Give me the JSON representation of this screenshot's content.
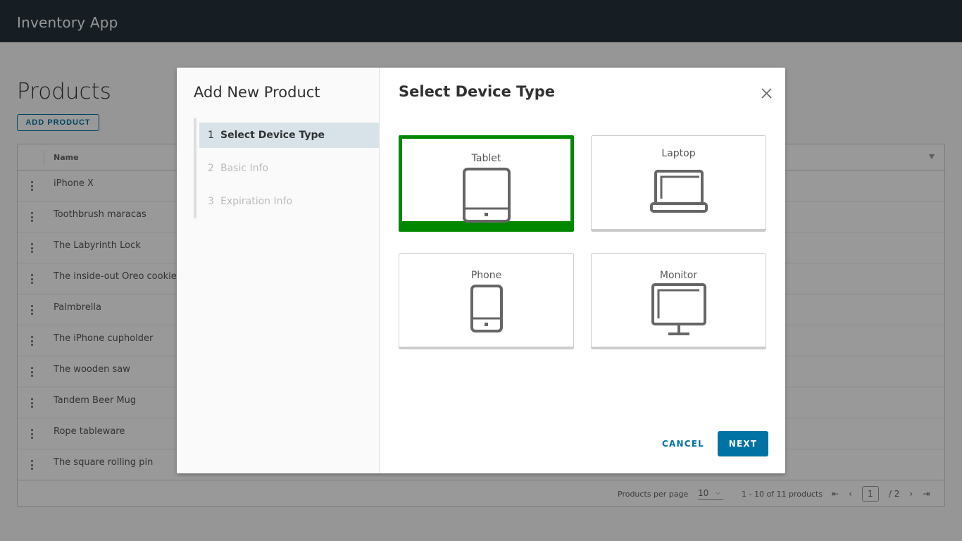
{
  "app": {
    "title": "Inventory App"
  },
  "page": {
    "title": "Products",
    "add_button": "ADD PRODUCT"
  },
  "grid": {
    "column_name": "Name",
    "rows": [
      "iPhone X",
      "Toothbrush maracas",
      "The Labyrinth Lock",
      "The inside-out Oreo cookie",
      "Palmbrella",
      "The iPhone cupholder",
      "The wooden saw",
      "Tandem Beer Mug",
      "Rope tableware",
      "The square rolling pin"
    ],
    "footer": {
      "per_page_label": "Products per page",
      "per_page_value": "10",
      "range_text": "1 - 10 of 11 products",
      "current_page": "1",
      "total_pages": "/ 2"
    }
  },
  "modal": {
    "side_title": "Add New Product",
    "steps": [
      {
        "num": "1",
        "label": "Select Device Type",
        "active": true
      },
      {
        "num": "2",
        "label": "Basic Info",
        "active": false
      },
      {
        "num": "3",
        "label": "Expiration Info",
        "active": false
      }
    ],
    "main_title": "Select Device Type",
    "options": [
      {
        "label": "Tablet",
        "icon": "tablet-icon",
        "selected": true
      },
      {
        "label": "Laptop",
        "icon": "laptop-icon",
        "selected": false
      },
      {
        "label": "Phone",
        "icon": "phone-icon",
        "selected": false
      },
      {
        "label": "Monitor",
        "icon": "monitor-icon",
        "selected": false
      }
    ],
    "cancel_label": "CANCEL",
    "next_label": "NEXT"
  },
  "colors": {
    "header_bg": "#25333d",
    "accent": "#0072a3",
    "selected": "#008800"
  }
}
